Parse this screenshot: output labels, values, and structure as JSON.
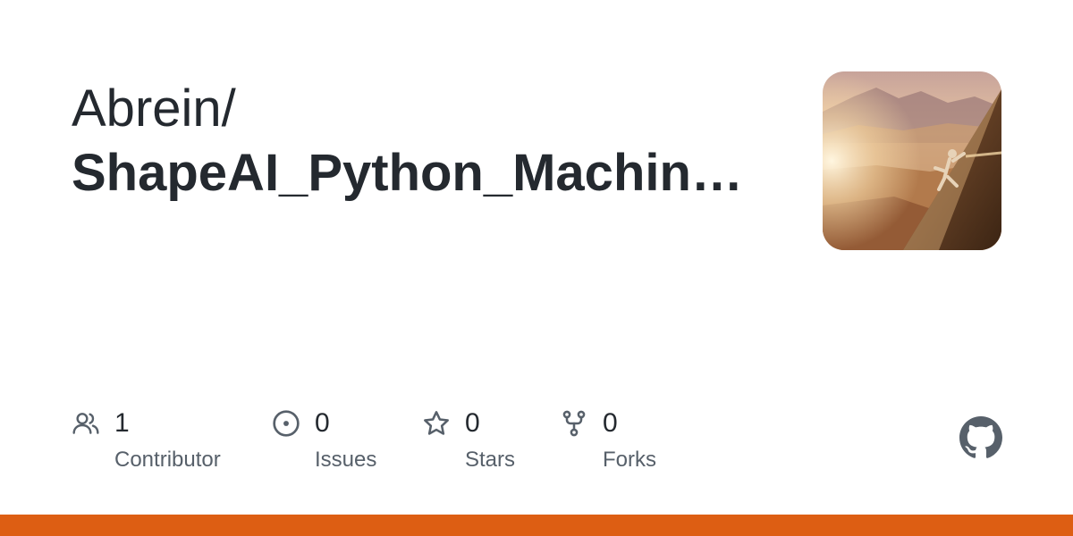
{
  "repo": {
    "owner": "Abrein/",
    "name": "ShapeAI_Python_Machin…"
  },
  "stats": {
    "contributors": {
      "count": "1",
      "label": "Contributor",
      "icon": "people-icon"
    },
    "issues": {
      "count": "0",
      "label": "Issues",
      "icon": "issue-opened-icon"
    },
    "stars": {
      "count": "0",
      "label": "Stars",
      "icon": "star-icon"
    },
    "forks": {
      "count": "0",
      "label": "Forks",
      "icon": "repo-forked-icon"
    }
  },
  "colors": {
    "text": "#24292f",
    "muted": "#57606a",
    "icon": "#57606a",
    "language_bar": "#dd5e13",
    "github_logo": "#57606a"
  },
  "avatar": {
    "description_icon": "avatar-image"
  }
}
